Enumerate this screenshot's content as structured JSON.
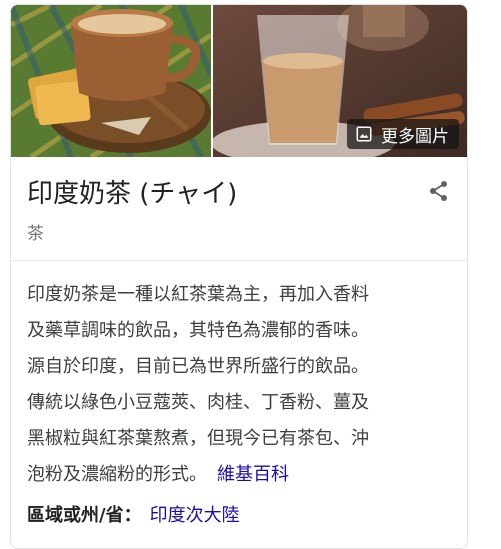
{
  "images": {
    "more_label": "更多圖片",
    "left_alt": "印度奶茶",
    "right_alt": "印度奶茶"
  },
  "entity": {
    "title": "印度奶茶 (チャイ)",
    "subtitle": "茶"
  },
  "description": {
    "lines": [
      "印度奶茶是一種以紅茶葉為主，再加入香料",
      "及藥草調味的飲品，其特色為濃郁的香味。",
      "源自於印度，目前已為世界所盛行的飲品。",
      "傳統以綠色小豆蔻莢、肉桂、丁香粉、薑及",
      "黑椒粒與紅茶葉熬煮，但現今已有茶包、沖",
      "泡粉及濃縮粉的形式。"
    ],
    "source_link": "維基百科"
  },
  "facts": {
    "region_label": "區域或州/省：",
    "region_value": "印度次大陸"
  },
  "icons": {
    "share": "share-icon",
    "image": "image-icon"
  },
  "colors": {
    "link": "#1a0dab",
    "secondary_text": "#70757a",
    "border": "#dfe1e5"
  }
}
